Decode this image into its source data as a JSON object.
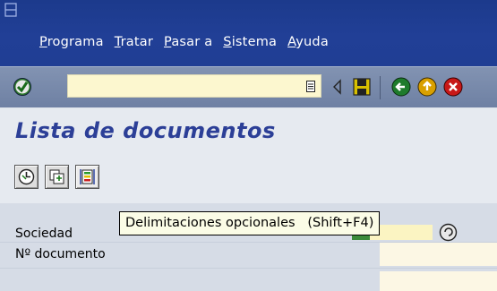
{
  "menubar": {
    "items": [
      {
        "label": "Programa"
      },
      {
        "label": "Tratar"
      },
      {
        "label": "Pasar a"
      },
      {
        "label": "Sistema"
      },
      {
        "label": "Ayuda"
      }
    ]
  },
  "toolbar": {
    "command_field": {
      "value": "",
      "placeholder": ""
    },
    "icons": [
      "enter-icon",
      "dropdown-icon",
      "back-arrow-icon",
      "save-icon",
      "back-icon",
      "exit-icon",
      "cancel-icon"
    ]
  },
  "title": "Lista de documentos",
  "app_toolbar": {
    "icons": [
      "execute-icon",
      "get-variant-icon",
      "optional-delimitations-icon"
    ]
  },
  "tooltip": {
    "text": "Delimitaciones opcionales   (Shift+F4)"
  },
  "selection": {
    "rows": [
      {
        "label": "Sociedad",
        "value": ""
      },
      {
        "label": "Nº documento",
        "value": ""
      }
    ]
  },
  "colors": {
    "menubar": "#213f96",
    "toolbar": "#7b8cab",
    "title": "#2c3f97",
    "input": "#fcf7cf"
  }
}
